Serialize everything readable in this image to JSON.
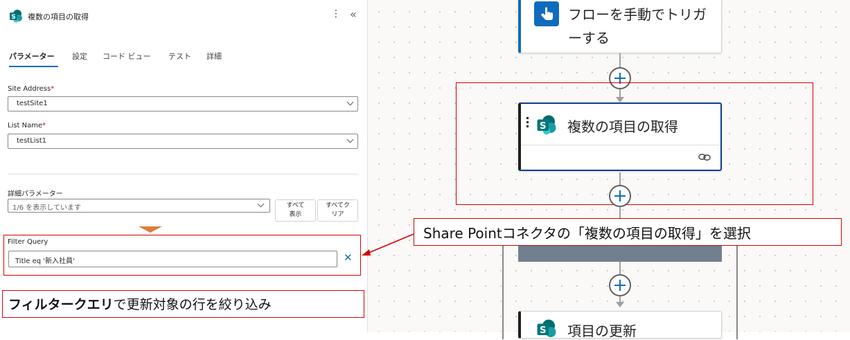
{
  "panel": {
    "title": "複数の項目の取得",
    "more_icon": "more-vertical-icon",
    "collapse_icon": "collapse-chevrons-icon",
    "tabs": [
      "パラメーター",
      "設定",
      "コード ビュー",
      "テスト",
      "詳細"
    ],
    "active_tab": "パラメーター",
    "site_address": {
      "label": "Site Address",
      "required_mark": "*",
      "value": "testSite1"
    },
    "list_name": {
      "label": "List Name",
      "required_mark": "*",
      "value": "testList1"
    },
    "advanced": {
      "label": "詳細パラメーター",
      "dropdown_value": "1/6 を表示しています",
      "show_all_line1": "すべて",
      "show_all_line2": "表示",
      "clear_all_line1": "すべてク",
      "clear_all_line2": "リア"
    },
    "filter_query": {
      "label": "Filter Query",
      "value": "Title eq '新入社員'",
      "clear_icon": "close-icon"
    }
  },
  "annotations": {
    "note_bold": "フィルタークエリ",
    "note_rest": "で更新対象の行を絞り込み",
    "callout": "Share Pointコネクタの「複数の項目の取得」を選択",
    "accent_color": "#d40000"
  },
  "flow": {
    "trigger_title": "フローを手動でトリガーする",
    "action_title": "複数の項目の取得",
    "update_title": "項目の更新",
    "link_icon": "link-icon",
    "brand_color": "#0f6cbd",
    "sharepoint_color": "#038387"
  }
}
